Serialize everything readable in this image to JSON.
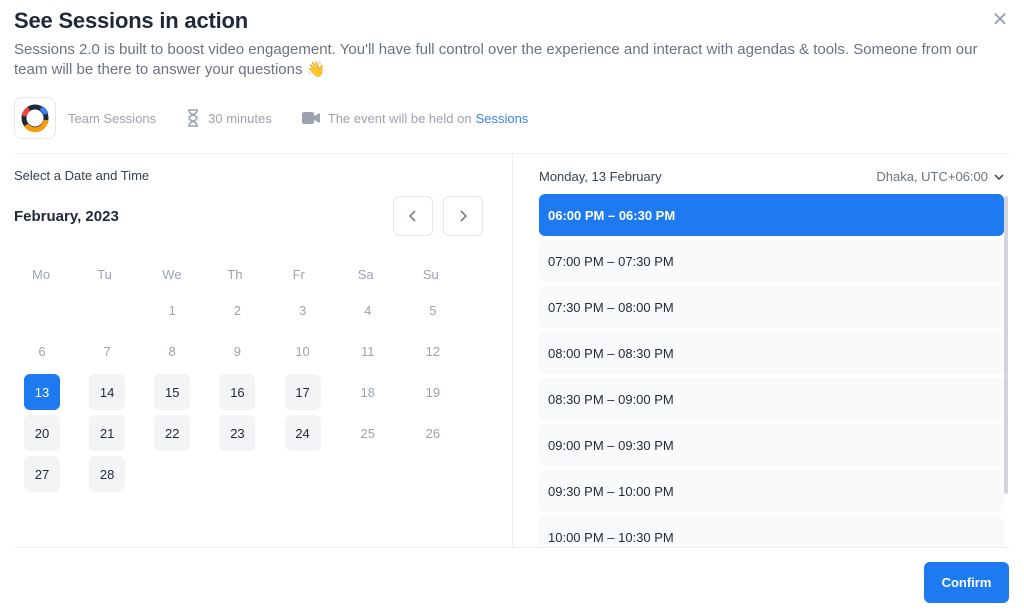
{
  "dialog": {
    "title": "See Sessions in action",
    "description": "Sessions 2.0 is built to boost video engagement. You'll have full control over the experience and interact with agendas & tools. Someone from our team will be there to answer your questions 👋",
    "close_icon": "close-icon"
  },
  "meta": {
    "organizer": "Team Sessions",
    "duration": "30 minutes",
    "location_prefix": "The event will be held on",
    "location_link": "Sessions"
  },
  "calendar": {
    "section_label": "Select a Date and Time",
    "month_label": "February, 2023",
    "weekdays": [
      "Mo",
      "Tu",
      "We",
      "Th",
      "Fr",
      "Sa",
      "Su"
    ],
    "weeks": [
      [
        "",
        "",
        "1",
        "2",
        "3",
        "4",
        "5"
      ],
      [
        "6",
        "7",
        "8",
        "9",
        "10",
        "11",
        "12"
      ],
      [
        "13",
        "14",
        "15",
        "16",
        "17",
        "18",
        "19"
      ],
      [
        "20",
        "21",
        "22",
        "23",
        "24",
        "25",
        "26"
      ],
      [
        "27",
        "28",
        "",
        "",
        "",
        "",
        ""
      ]
    ],
    "available_days": [
      "13",
      "14",
      "15",
      "16",
      "17",
      "20",
      "21",
      "22",
      "23",
      "24",
      "27",
      "28"
    ],
    "selected_day": "13"
  },
  "times": {
    "date_label": "Monday, 13 February",
    "timezone": "Dhaka, UTC+06:00",
    "slots": [
      "06:00 PM – 06:30 PM",
      "07:00 PM – 07:30 PM",
      "07:30 PM – 08:00 PM",
      "08:00 PM – 08:30 PM",
      "08:30 PM – 09:00 PM",
      "09:00 PM – 09:30 PM",
      "09:30 PM – 10:00 PM",
      "10:00 PM – 10:30 PM"
    ],
    "selected_index": 0
  },
  "footer": {
    "confirm_label": "Confirm"
  },
  "colors": {
    "accent": "#1d7af0",
    "link": "#3b82f6"
  }
}
